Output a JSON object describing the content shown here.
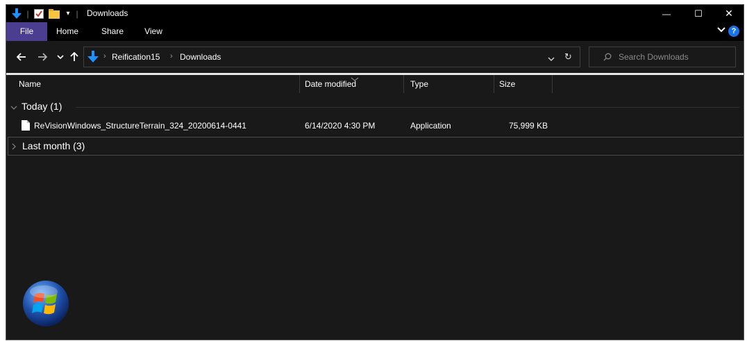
{
  "window": {
    "title": "Downloads",
    "minimize_glyph": "—",
    "maximize_glyph": "☐",
    "close_glyph": "✕"
  },
  "ribbon": {
    "tabs": [
      "File",
      "Home",
      "Share",
      "View"
    ]
  },
  "address": {
    "breadcrumb": [
      "Reification15",
      "Downloads"
    ],
    "search_placeholder": "Search Downloads"
  },
  "columns": [
    "Name",
    "Date modified",
    "Type",
    "Size"
  ],
  "groups": [
    {
      "label": "Today (1)",
      "expanded": true,
      "items": [
        {
          "name": "ReVisionWindows_StructureTerrain_324_20200614-0441",
          "date_modified": "6/14/2020 4:30 PM",
          "type": "Application",
          "size": "75,999 KB"
        }
      ]
    },
    {
      "label": "Last month (3)",
      "expanded": false,
      "items": []
    }
  ],
  "colors": {
    "background": "#191919",
    "titlebar": "#000000",
    "file_tab": "#4b3d8f",
    "accent_blue": "#1e90ff",
    "help_blue": "#1a73e8"
  },
  "icons": {
    "quick_access": [
      "download-arrow-icon",
      "properties-check-icon",
      "new-folder-icon",
      "customize-dropdown-icon"
    ],
    "nav": [
      "back-arrow-icon",
      "forward-arrow-icon",
      "recent-chevron-icon",
      "up-arrow-icon"
    ],
    "file": "document-icon",
    "logo": "windows-orb-icon"
  }
}
